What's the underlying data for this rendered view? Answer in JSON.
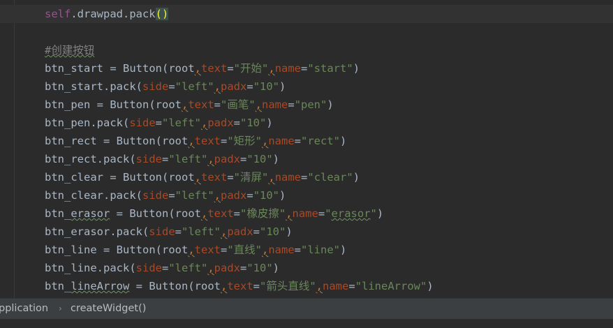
{
  "editor": {
    "top_partial": "                                                                                                ",
    "lines": [
      {
        "name": "line-drawpad-pack"
      },
      {
        "name": "line-blank"
      },
      {
        "name": "line-comment"
      },
      {
        "name": "line-btn-start"
      },
      {
        "name": "line-btn-start-pack"
      },
      {
        "name": "line-btn-pen"
      },
      {
        "name": "line-btn-pen-pack"
      },
      {
        "name": "line-btn-rect"
      },
      {
        "name": "line-btn-rect-pack"
      },
      {
        "name": "line-btn-clear"
      },
      {
        "name": "line-btn-clear-pack"
      },
      {
        "name": "line-btn-erasor"
      },
      {
        "name": "line-btn-erasor-pack"
      },
      {
        "name": "line-btn-line"
      },
      {
        "name": "line-btn-line-pack"
      },
      {
        "name": "line-btn-linearrow"
      }
    ],
    "code": {
      "self": "self",
      "drawpad_pack": ".drawpad.pack",
      "paren_pair": "()",
      "comment": "#创建按钮",
      "root": "root",
      "button_call": "Button(",
      "pack_call": ".pack(",
      "eq": " = ",
      "text_kw": "text",
      "name_kw": "name",
      "side_kw": "side",
      "padx_kw": "padx",
      "comma": ",",
      "equals": "=",
      "close": ")",
      "left_str": "\"left\"",
      "ten_str": "\"10\"",
      "vars": {
        "start": "btn_start",
        "pen": "btn_pen",
        "rect": "btn_rect",
        "clear": "btn_clear",
        "erasor_prefix": "btn_",
        "erasor_word": "erasor",
        "line": "btn_line",
        "linearrow_prefix": "btn_",
        "linearrow_word": "lineArrow"
      },
      "texts": {
        "start": "\"开始\"",
        "pen": "\"画笔\"",
        "rect": "\"矩形\"",
        "clear": "\"清屏\"",
        "erasor": "\"橡皮擦\"",
        "line": "\"直线\"",
        "linearrow": "\"箭头直线\""
      },
      "names": {
        "start": "\"start\"",
        "pen": "\"pen\"",
        "rect": "\"rect\"",
        "clear": "\"clear\"",
        "erasor_q1": "\"",
        "erasor_word": "erasor",
        "erasor_q2": "\"",
        "line": "\"line\"",
        "linearrow": "\"lineArrow\""
      }
    }
  },
  "breadcrumb": {
    "item1": "pplication",
    "separator": "›",
    "item2": "createWidget()"
  },
  "colors": {
    "background": "#2b2b2b",
    "keyword_arg": "#aa4926",
    "string": "#6a8759",
    "self": "#94558d",
    "comment": "#808080",
    "default_text": "#a9b7c6",
    "statusbar": "#3c3f41"
  }
}
